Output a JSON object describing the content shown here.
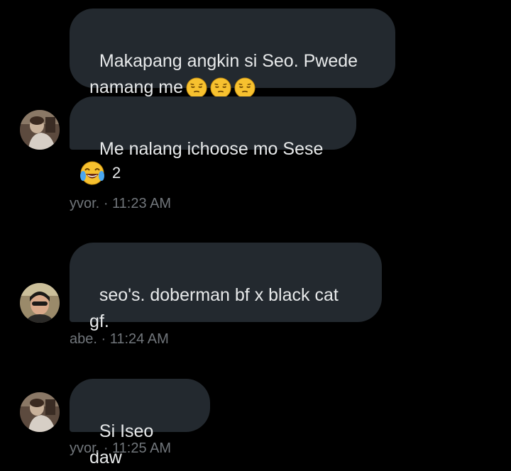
{
  "messages": [
    {
      "text": "Makapang angkin si Seo. Pwede\nnamang me",
      "emojis": [
        "pensive-face",
        "pensive-face",
        "pensive-face"
      ]
    },
    {
      "text": "Me nalang ichoose mo Sese",
      "reaction": {
        "emoji": "face-with-tears-of-joy",
        "count": "2"
      },
      "sender": "yvor.",
      "separator": "·",
      "time": "11:23 AM"
    },
    {
      "text": "seo's. doberman bf x black cat\ngf.",
      "sender": "abe.",
      "separator": "·",
      "time": "11:24 AM"
    },
    {
      "text": "Si Iseo daw",
      "sender": "yvor.",
      "separator": "·",
      "time": "11:25 AM"
    }
  ],
  "colors": {
    "background": "#000000",
    "bubble": "#23292f",
    "text": "#e7e9ea",
    "meta_text": "#71767b",
    "emoji_yellow": "#f7c12f"
  }
}
